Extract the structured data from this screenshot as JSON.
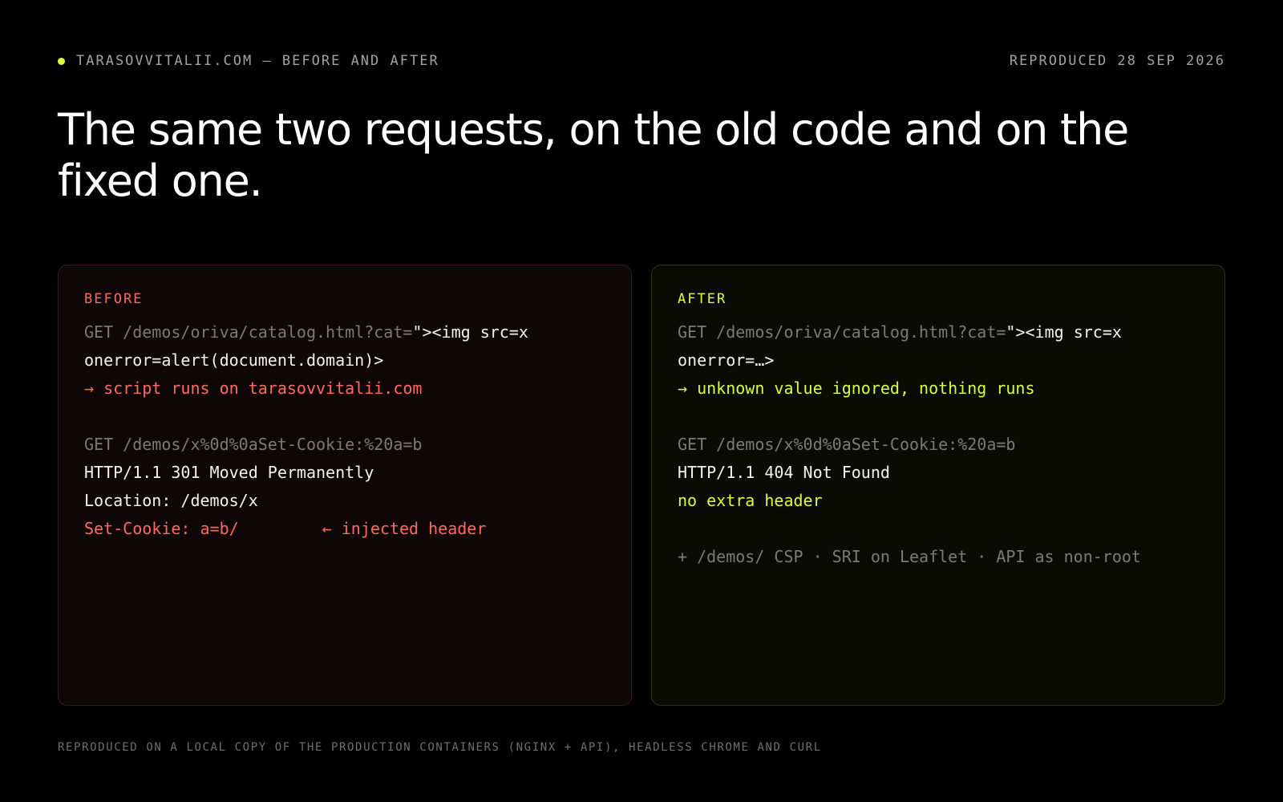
{
  "header": {
    "site": "TARASOVVITALII.COM — BEFORE AND AFTER",
    "date": "REPRODUCED 28 SEP 2026"
  },
  "title": "The same two requests, on the old code and on the fixed one.",
  "colors": {
    "accent": "#d7ff3c",
    "danger": "#ff6b5f"
  },
  "before": {
    "label": "BEFORE",
    "req1_path": "GET /demos/oriva/catalog.html?cat=",
    "req1_payload": "\"><img src=x",
    "req1_payload_cont": "onerror=alert(document.domain)>",
    "req1_result": "→ script runs on tarasovvitalii.com",
    "req2_path": "GET /demos/x%0d%0aSet-Cookie:%20a=b",
    "resp_status": "HTTP/1.1 301 Moved Permanently",
    "resp_location": "Location: /demos/x",
    "resp_cookie": "Set-Cookie: a=b/",
    "resp_cookie_note": "← injected header"
  },
  "after": {
    "label": "AFTER",
    "req1_path": "GET /demos/oriva/catalog.html?cat=",
    "req1_payload": "\"><img src=x",
    "req1_payload_cont": "onerror=…>",
    "req1_result": "→ unknown value ignored, nothing runs",
    "req2_path": "GET /demos/x%0d%0aSet-Cookie:%20a=b",
    "resp_status": "HTTP/1.1 404 Not Found",
    "resp_note": "no extra header",
    "extras": "+ /demos/ CSP · SRI on Leaflet · API as non-root"
  },
  "footer": "REPRODUCED ON A LOCAL COPY OF THE PRODUCTION CONTAINERS (NGINX + API), HEADLESS CHROME AND CURL"
}
